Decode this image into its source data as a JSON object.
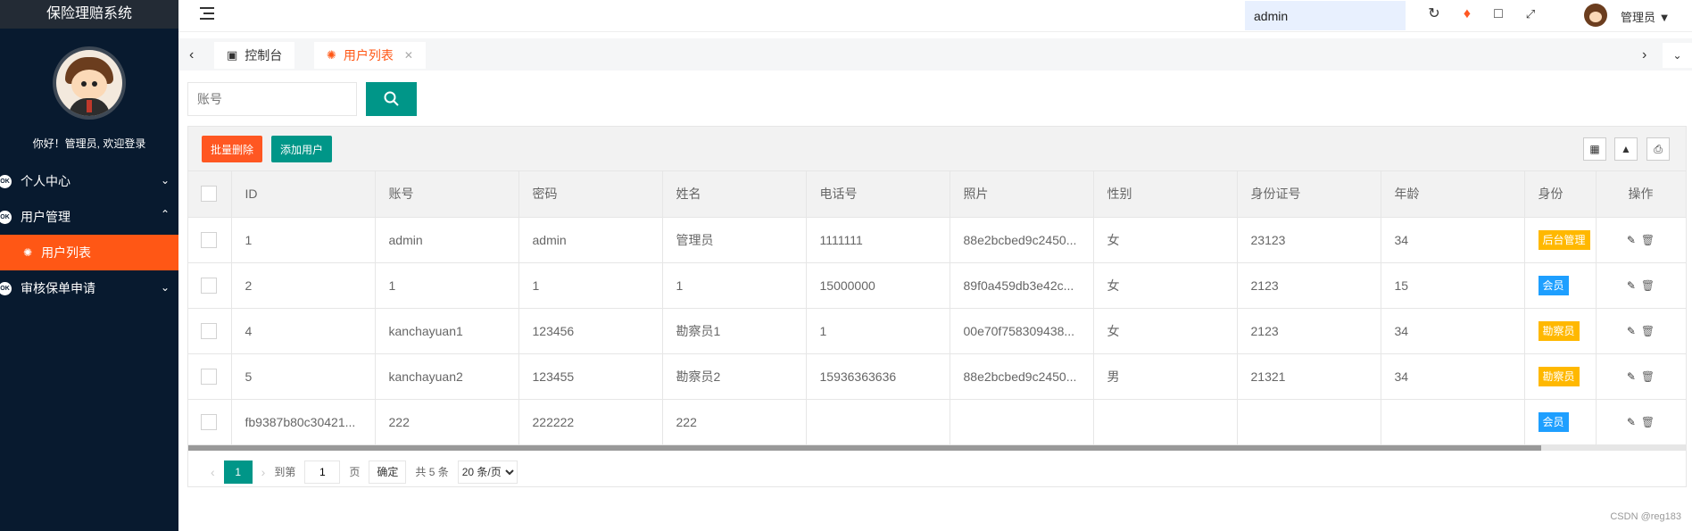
{
  "sidebar": {
    "brand": "保险理赔系统",
    "welcome": "你好！管理员, 欢迎登录",
    "menu": [
      {
        "label": "个人中心"
      },
      {
        "label": "用户管理"
      },
      {
        "label": "用户列表"
      },
      {
        "label": "审核保单申请"
      }
    ]
  },
  "header": {
    "search_value": "admin",
    "user_name": "管理员"
  },
  "tabs": [
    {
      "label": "控制台"
    },
    {
      "label": "用户列表"
    }
  ],
  "search": {
    "placeholder": "账号"
  },
  "toolbar": {
    "batch_delete": "批量删除",
    "add_user": "添加用户"
  },
  "table": {
    "columns": [
      "ID",
      "账号",
      "密码",
      "姓名",
      "电话号",
      "照片",
      "性别",
      "身份证号",
      "年龄",
      "身份",
      "操作"
    ],
    "rows": [
      {
        "id": "1",
        "account": "admin",
        "password": "admin",
        "name": "管理员",
        "phone": "1111111",
        "photo": "88e2bcbed9c2450...",
        "gender": "女",
        "idcard": "23123",
        "age": "34",
        "role": "后台管理",
        "role_color": "#ffb800"
      },
      {
        "id": "2",
        "account": "1",
        "password": "1",
        "name": "1",
        "phone": "15000000",
        "photo": "89f0a459db3e42c...",
        "gender": "女",
        "idcard": "2123",
        "age": "15",
        "role": "会员",
        "role_color": "#1e9fff"
      },
      {
        "id": "4",
        "account": "kanchayuan1",
        "password": "123456",
        "name": "勘察员1",
        "phone": "1",
        "photo": "00e70f758309438...",
        "gender": "女",
        "idcard": "2123",
        "age": "34",
        "role": "勘察员",
        "role_color": "#ffb800"
      },
      {
        "id": "5",
        "account": "kanchayuan2",
        "password": "123455",
        "name": "勘察员2",
        "phone": "15936363636",
        "photo": "88e2bcbed9c2450...",
        "gender": "男",
        "idcard": "21321",
        "age": "34",
        "role": "勘察员",
        "role_color": "#ffb800"
      },
      {
        "id": "fb9387b80c30421...",
        "account": "222",
        "password": "222222",
        "name": "222",
        "phone": "",
        "photo": "",
        "gender": "",
        "idcard": "",
        "age": "",
        "role": "会员",
        "role_color": "#1e9fff"
      }
    ]
  },
  "pager": {
    "current": "1",
    "goto_label": "到第",
    "goto_value": "1",
    "page_unit": "页",
    "confirm": "确定",
    "total": "共 5 条",
    "page_size": "20 条/页"
  },
  "watermark": "CSDN @reg183"
}
